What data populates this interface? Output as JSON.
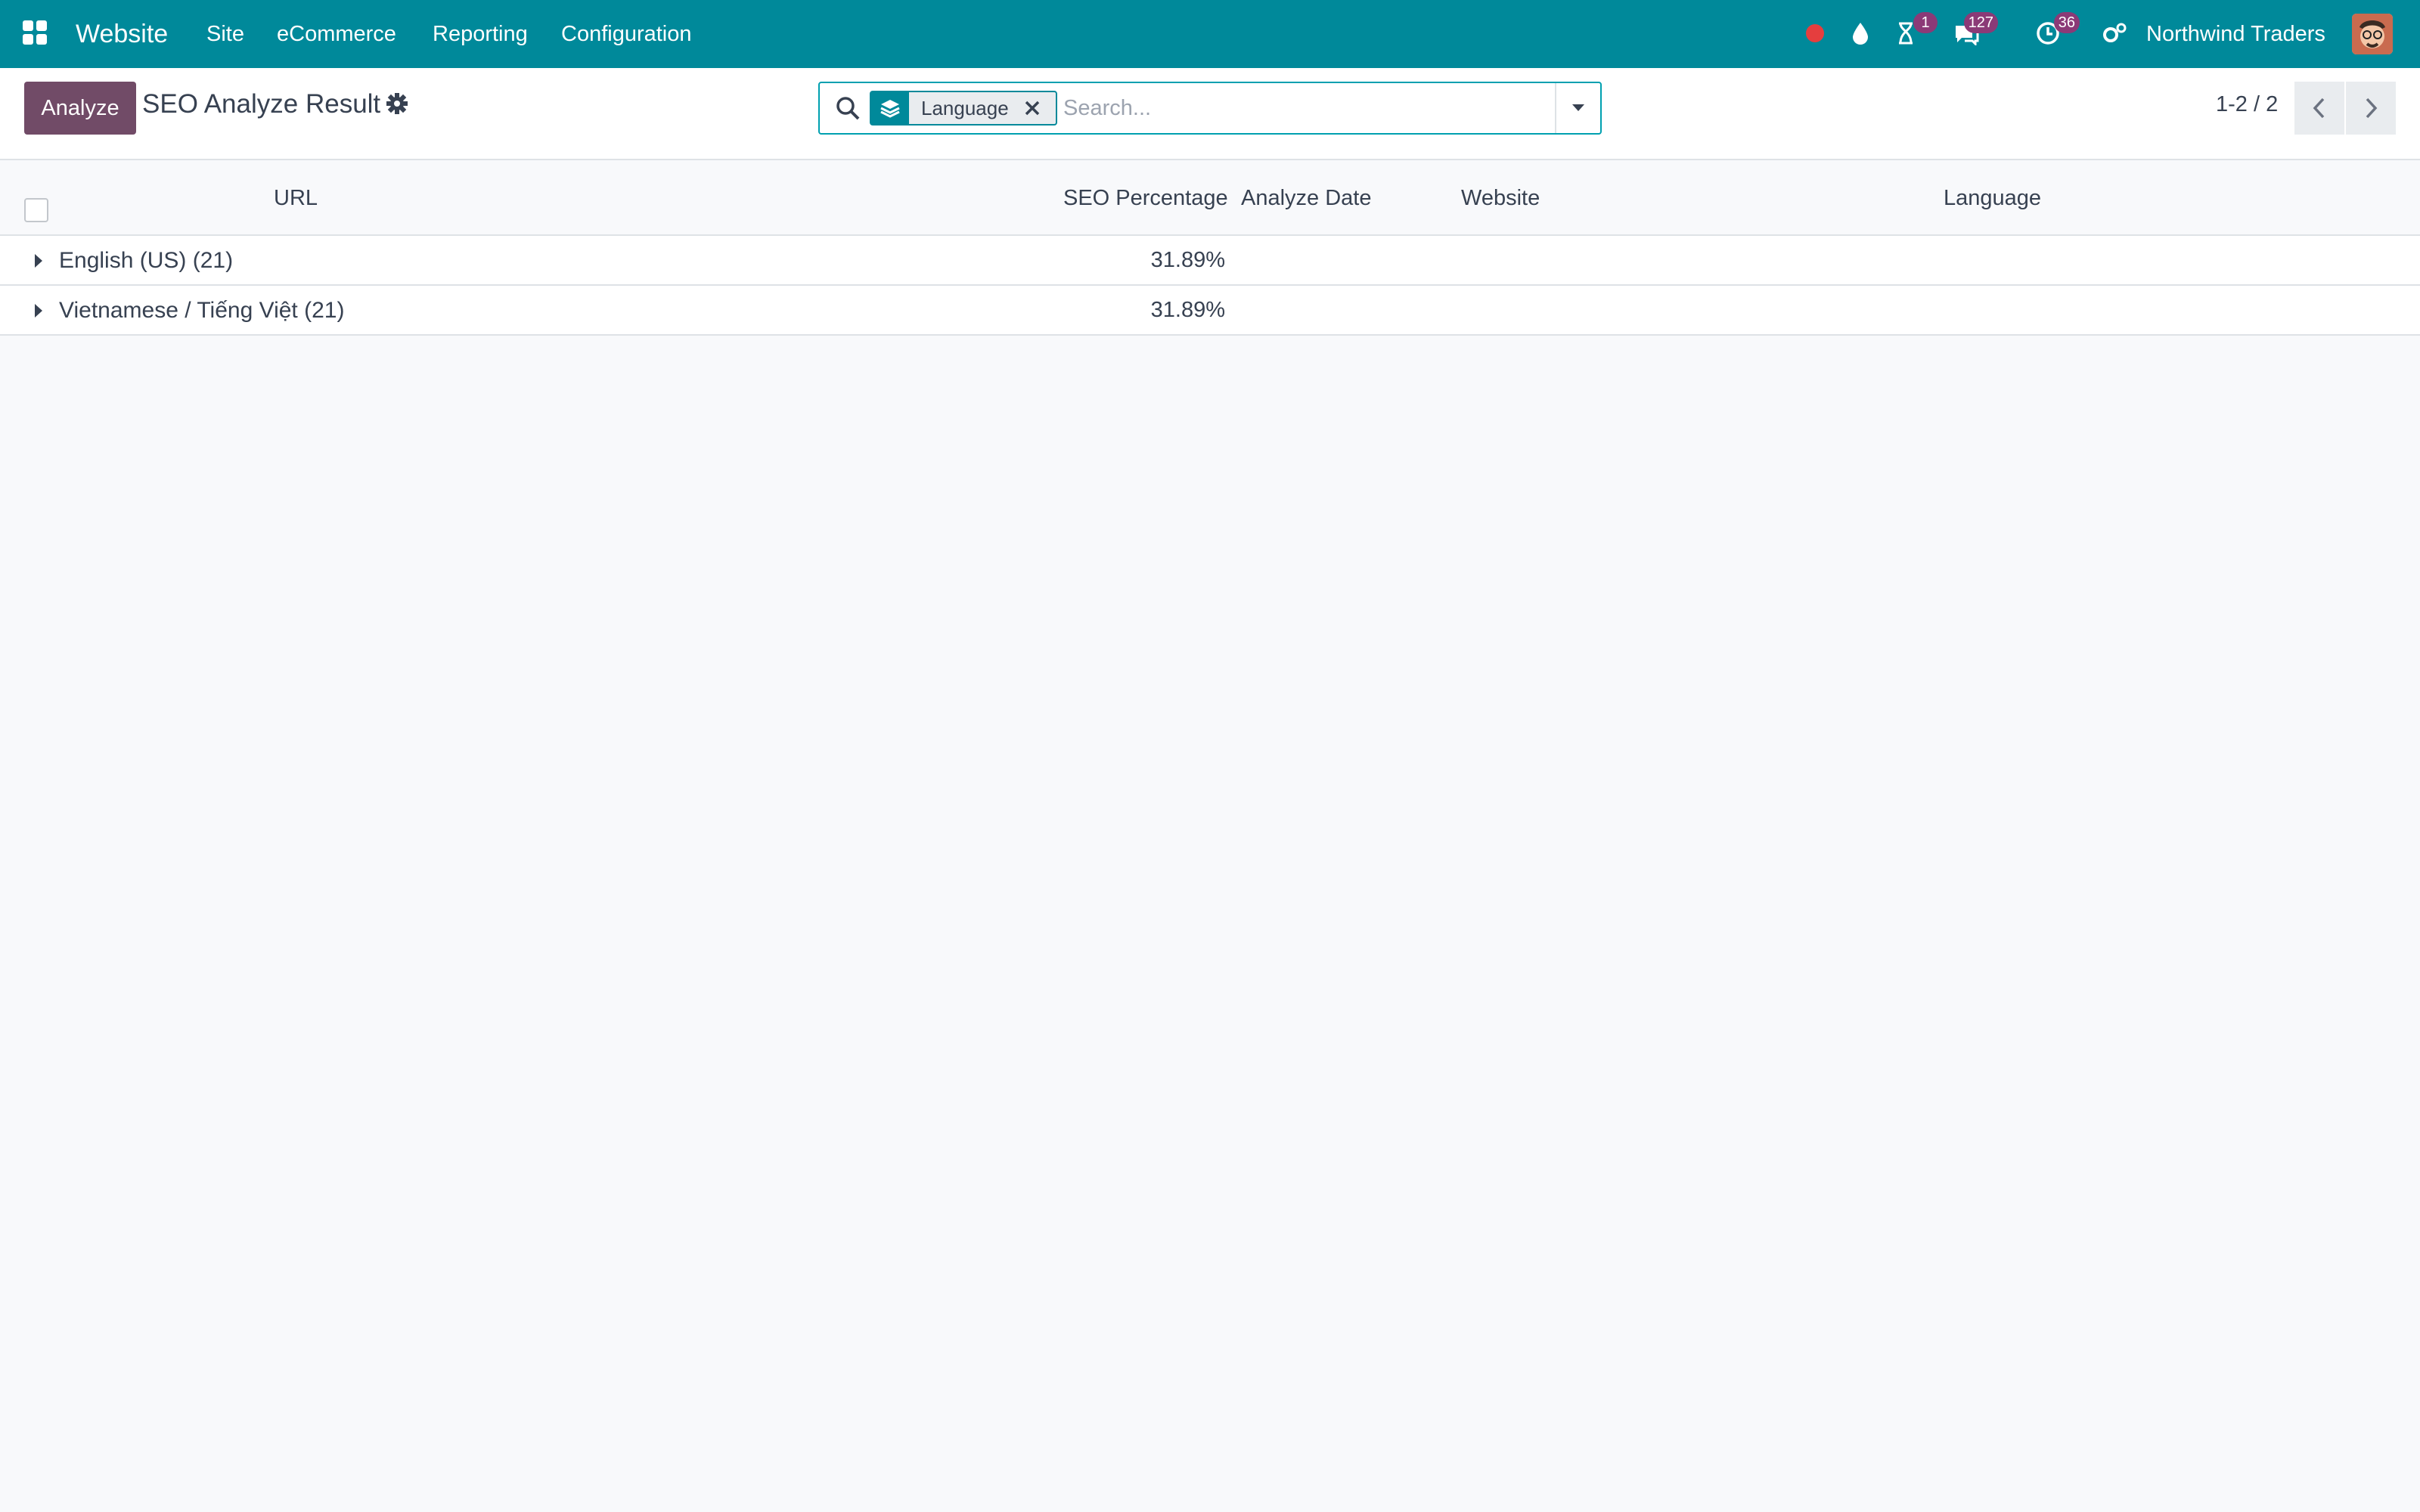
{
  "navbar": {
    "brand": "Website",
    "menu": [
      "Site",
      "eCommerce",
      "Reporting",
      "Configuration"
    ],
    "badges": {
      "activities_timer": "1",
      "messages": "127",
      "activities": "36"
    },
    "company": "Northwind Traders",
    "colors": {
      "bar": "#00899a",
      "badge": "#8b3a77",
      "recording_dot": "#e53e3e"
    }
  },
  "control_panel": {
    "primary_button": "Analyze",
    "title": "SEO Analyze Result",
    "search": {
      "facet_label": "Language",
      "placeholder": "Search..."
    },
    "pager": "1-2 / 2"
  },
  "list": {
    "columns": [
      "URL",
      "SEO Percentage",
      "Analyze Date",
      "Website",
      "Language"
    ],
    "groups": [
      {
        "label": "English (US) (21)",
        "seo_percentage": "31.89%"
      },
      {
        "label": "Vietnamese / Tiếng Việt (21)",
        "seo_percentage": "31.89%"
      }
    ]
  }
}
